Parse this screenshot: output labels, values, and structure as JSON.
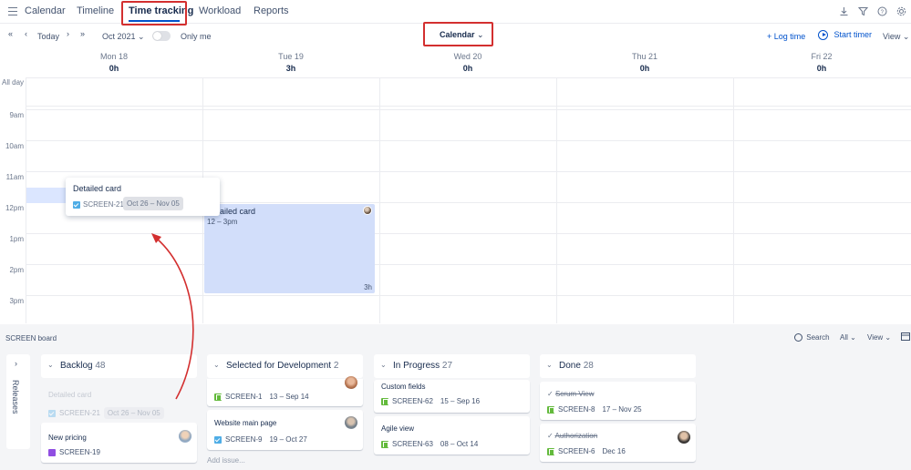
{
  "nav": {
    "tabs": [
      "Calendar",
      "Timeline",
      "Time tracking",
      "Workload",
      "Reports"
    ],
    "active": "Time tracking",
    "icons": [
      "download-icon",
      "filter-icon",
      "help-icon",
      "settings-icon"
    ]
  },
  "toolbar": {
    "first": "«",
    "prev": "‹",
    "today": "Today",
    "next": "›",
    "last": "»",
    "month": "Oct 2021",
    "only_me": "Only me",
    "view_mode": "Calendar",
    "log_time": "+ Log time",
    "start_timer": "Start timer",
    "view": "View"
  },
  "calendar": {
    "days": [
      {
        "name": "Mon 18",
        "hours": "0h"
      },
      {
        "name": "Tue 19",
        "hours": "3h"
      },
      {
        "name": "Wed 20",
        "hours": "0h"
      },
      {
        "name": "Thu 21",
        "hours": "0h"
      },
      {
        "name": "Fri 22",
        "hours": "0h"
      }
    ],
    "all_day": "All day",
    "times": [
      "9am",
      "10am",
      "11am",
      "12pm",
      "1pm",
      "2pm",
      "3pm"
    ],
    "event": {
      "title": "Detailed card",
      "time": "12 – 3pm",
      "duration": "3h"
    },
    "popover": {
      "title": "Detailed card",
      "key": "SCREEN-21",
      "dates": "Oct 26 – Nov 05"
    }
  },
  "board": {
    "title": "SCREEN board",
    "search": "Search",
    "filter": "All",
    "view": "View",
    "releases": "Releases",
    "add_issue": "Add issue...",
    "columns": [
      {
        "name": "Backlog",
        "count": "48"
      },
      {
        "name": "Selected for Development",
        "count": "2"
      },
      {
        "name": "In Progress",
        "count": "27"
      },
      {
        "name": "Done",
        "count": "28"
      }
    ],
    "cards": {
      "backlog": [
        {
          "title": "Detailed card",
          "key": "SCREEN-21",
          "dates": "Oct 26 – Nov 05"
        },
        {
          "title": "New pricing",
          "key": "SCREEN-19"
        }
      ],
      "selected": [
        {
          "key": "SCREEN-1",
          "dates": "13 – Sep 14"
        },
        {
          "title": "Website main page",
          "key": "SCREEN-9",
          "dates": "19 – Oct 27"
        }
      ],
      "progress": [
        {
          "title": "Custom fields",
          "key": "SCREEN-62",
          "dates": "15 – Sep 16"
        },
        {
          "title": "Agile view",
          "key": "SCREEN-63",
          "dates": "08 – Oct 14"
        }
      ],
      "done": [
        {
          "title": "Scrum View",
          "key": "SCREEN-8",
          "dates": "17 – Nov 25"
        },
        {
          "title": "Authorization",
          "key": "SCREEN-6",
          "dates": "Dec 16"
        }
      ]
    }
  }
}
